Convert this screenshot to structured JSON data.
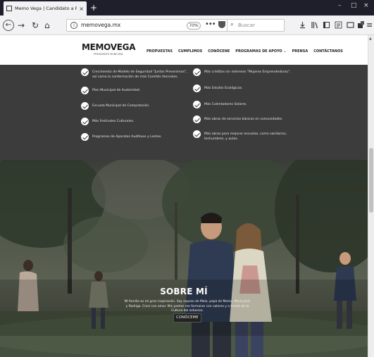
{
  "browser": {
    "tab_title": "Memo Vega | Candidato a Pre...",
    "tab_close": "×",
    "new_tab": "+",
    "url": "memovega.mx",
    "zoom": "70%",
    "search_placeholder": "Buscar"
  },
  "site": {
    "logo": "MEMOVEGA",
    "logo_sub": "PRESIDENTE MUNICIPAL",
    "menu": [
      "PROPUESTAS",
      "CUMPLIMOS",
      "CONÓCENE",
      "PROGRAMAS DE APOYO ⌄",
      "PRENSA",
      "CONTÁCTANOS"
    ]
  },
  "achievements": {
    "left": [
      "Crecimiento de Modelo de Seguridad \"Juntos Prevenimos\", así como la conformación de más Comités Vecinales.",
      "Plan Municipal de Austeridad.",
      "Escuela Municipal de Computación.",
      "Más Festivales Culturales.",
      "Programas de Aparatos Auditivos y Lentes."
    ],
    "right": [
      "Más créditos sin intereses \"Mujeres Emprendedoras\".",
      "Más Estufas Ecológicas.",
      "Más Calentadores Solares.",
      "Más obras de servicios básicos en comunidades.",
      "Más obras para mejorar escuelas, como sanitarios, techumbres, y aulas."
    ]
  },
  "hero": {
    "title": "SOBRE MÍ",
    "paragraph": "Mi familia es mi gran inspiración. Soy esposo de Male, papá de Memo, María José y Rodrigo. Crecí con amor. Mis padres me formaron con valores y a través de la Cultura del esfuerzo.",
    "button": "CONÓCEME"
  }
}
